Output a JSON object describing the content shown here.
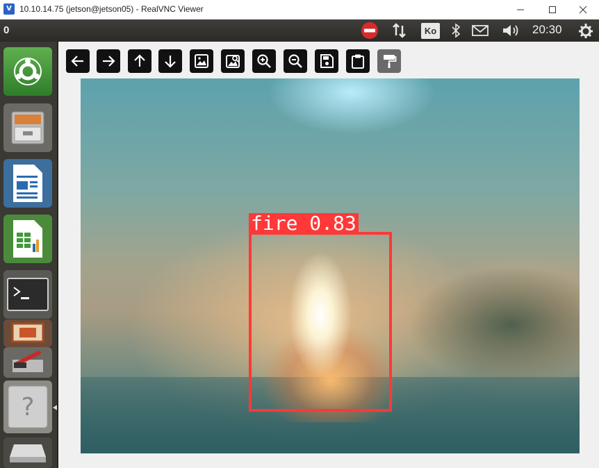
{
  "window": {
    "title": "10.10.14.75 (jetson@jetson05) - RealVNC Viewer",
    "app_icon": "realvnc-icon",
    "controls": [
      "minimize",
      "maximize",
      "close"
    ]
  },
  "panel": {
    "workspace_number": "0",
    "keyboard_layout": "Ko",
    "clock": "20:30",
    "indicators": [
      "no-entry-icon",
      "network-transfer-icon",
      "keyboard-layout-badge",
      "bluetooth-icon",
      "mail-icon",
      "volume-icon",
      "clock",
      "gear-icon"
    ],
    "accent_red": "#d62b2b"
  },
  "launcher": {
    "items": [
      {
        "name": "ubuntu-dash",
        "icon": "ubuntu-logo-icon"
      },
      {
        "name": "files",
        "icon": "file-cabinet-icon"
      },
      {
        "name": "writer",
        "icon": "document-icon"
      },
      {
        "name": "calc",
        "icon": "spreadsheet-icon"
      },
      {
        "name": "terminal",
        "icon": "terminal-icon"
      },
      {
        "name": "impress",
        "icon": "presentation-icon"
      },
      {
        "name": "settings",
        "icon": "tools-icon"
      },
      {
        "name": "help",
        "icon": "help-icon"
      },
      {
        "name": "trash",
        "icon": "drive-icon"
      }
    ]
  },
  "toolbar": {
    "buttons": [
      {
        "name": "back",
        "icon": "arrow-left-icon"
      },
      {
        "name": "forward",
        "icon": "arrow-right-icon"
      },
      {
        "name": "up",
        "icon": "arrow-up-icon"
      },
      {
        "name": "down",
        "icon": "arrow-down-icon"
      },
      {
        "name": "image",
        "icon": "image-icon"
      },
      {
        "name": "image-search",
        "icon": "image-search-icon"
      },
      {
        "name": "zoom-in",
        "icon": "zoom-in-icon"
      },
      {
        "name": "zoom-out",
        "icon": "zoom-out-icon"
      },
      {
        "name": "save",
        "icon": "save-icon"
      },
      {
        "name": "clipboard",
        "icon": "clipboard-icon"
      },
      {
        "name": "paint",
        "icon": "paint-roller-icon"
      }
    ]
  },
  "detection": {
    "label": "fire 0.83",
    "box_color": "#ff3838"
  }
}
